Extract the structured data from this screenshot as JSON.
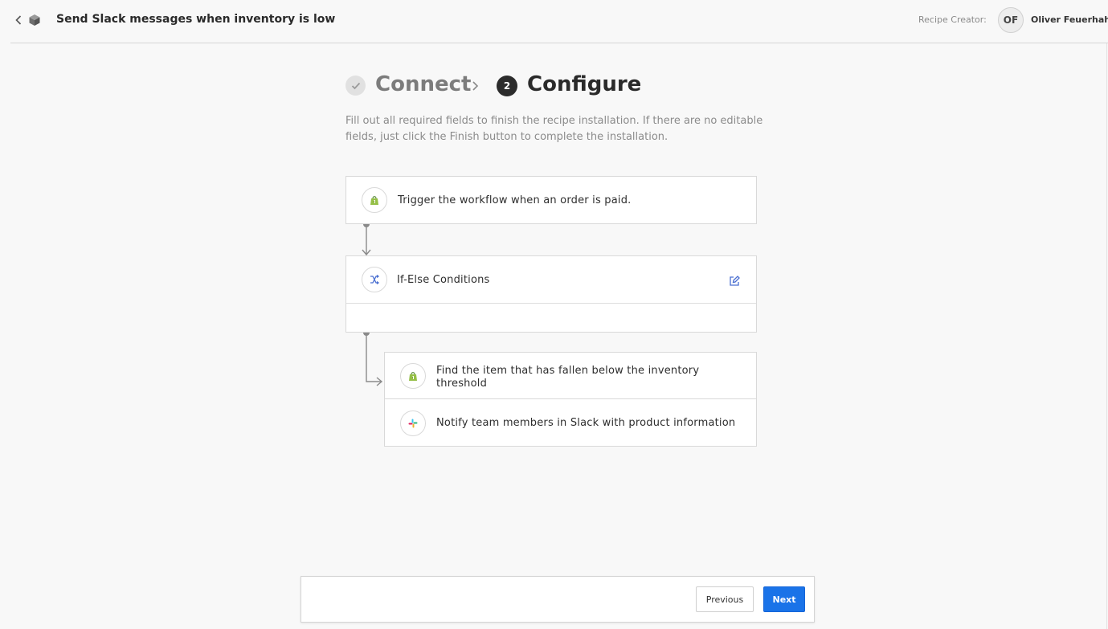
{
  "header": {
    "title": "Send Slack messages when inventory is low",
    "back_icon": "chevron-left-icon",
    "app_icon": "cube-icon",
    "creator_label": "Recipe Creator:",
    "avatar_initials": "OF",
    "creator_name": "Oliver Feuerhahn"
  },
  "steps": [
    {
      "label": "Connect",
      "status": "done",
      "icon": "check-icon"
    },
    {
      "number": "2",
      "label": "Configure",
      "status": "active"
    }
  ],
  "description": "Fill out all required fields to finish the recipe installation. If there are no editable fields, just click the Finish button to complete the installation.",
  "workflow": {
    "trigger": {
      "text": "Trigger the workflow when an order is paid.",
      "icon": "shopify-icon"
    },
    "condition": {
      "text": "If-Else Conditions",
      "icon": "shuffle-icon",
      "edit_icon": "edit-icon"
    },
    "actions": [
      {
        "text": "Find the item that has fallen below the inventory threshold",
        "icon": "shopify-icon"
      },
      {
        "text": "Notify team members in Slack with product information",
        "icon": "slack-icon"
      }
    ]
  },
  "footer": {
    "previous_label": "Previous",
    "next_label": "Next"
  },
  "colors": {
    "accent": "#1a73e8",
    "shopify_green": "#95bf47",
    "condition_blue": "#4a6fd1"
  }
}
